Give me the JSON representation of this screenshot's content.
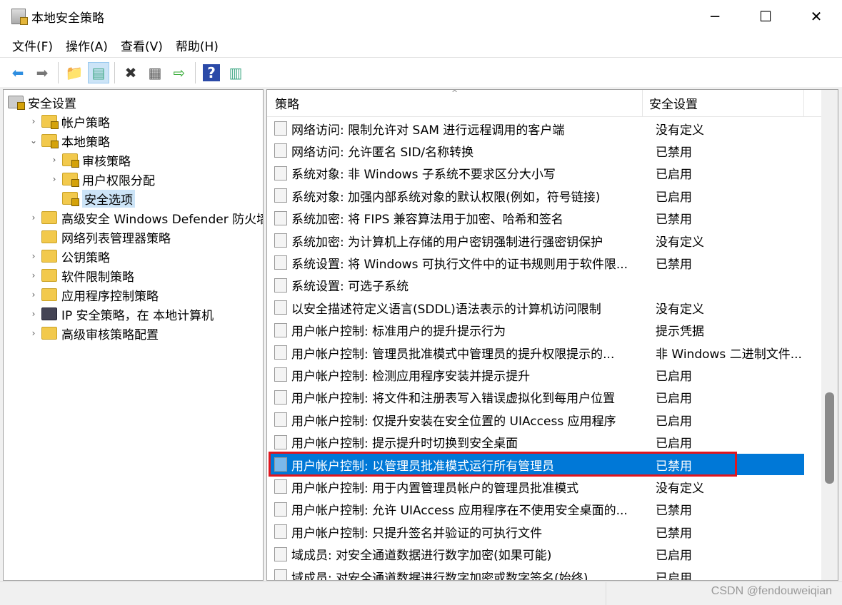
{
  "window": {
    "title": "本地安全策略",
    "minimize": "─",
    "maximize": "☐",
    "close": "✕"
  },
  "menu": [
    "文件(F)",
    "操作(A)",
    "查看(V)",
    "帮助(H)"
  ],
  "toolbar": [
    {
      "name": "back-icon",
      "glyph": "⬅",
      "color": "#2e8ee0",
      "active": false
    },
    {
      "name": "forward-icon",
      "glyph": "➡",
      "color": "#777",
      "active": false
    },
    {
      "sep": true
    },
    {
      "name": "up-folder-icon",
      "glyph": "📁",
      "color": "#d9a520",
      "active": false
    },
    {
      "name": "show-hide-tree-icon",
      "glyph": "▤",
      "color": "#4a8",
      "active": true
    },
    {
      "sep": true
    },
    {
      "name": "delete-icon",
      "glyph": "✖",
      "color": "#333",
      "active": false
    },
    {
      "name": "properties-icon",
      "glyph": "▦",
      "color": "#555",
      "active": false
    },
    {
      "name": "export-list-icon",
      "glyph": "⇨",
      "color": "#3a3",
      "active": false
    },
    {
      "sep": true
    },
    {
      "name": "help-icon",
      "glyph": "?",
      "color": "#fff",
      "bg": "#2b4aa8",
      "active": false
    },
    {
      "name": "show-action-pane-icon",
      "glyph": "▥",
      "color": "#4a8",
      "active": false
    }
  ],
  "tree": [
    {
      "label": "安全设置",
      "level": 0,
      "chev": "",
      "icon": "shield"
    },
    {
      "label": "帐户策略",
      "level": 1,
      "chev": "›",
      "icon": "lock"
    },
    {
      "label": "本地策略",
      "level": 1,
      "chev": "⌄",
      "icon": "lock"
    },
    {
      "label": "审核策略",
      "level": 2,
      "chev": "›",
      "icon": "lock"
    },
    {
      "label": "用户权限分配",
      "level": 2,
      "chev": "›",
      "icon": "lock"
    },
    {
      "label": "安全选项",
      "level": 2,
      "chev": "",
      "icon": "lock",
      "selected": true
    },
    {
      "label": "高级安全 Windows Defender 防火墙",
      "level": 1,
      "chev": "›",
      "icon": "folder"
    },
    {
      "label": "网络列表管理器策略",
      "level": 1,
      "chev": "",
      "icon": "folder"
    },
    {
      "label": "公钥策略",
      "level": 1,
      "chev": "›",
      "icon": "folder"
    },
    {
      "label": "软件限制策略",
      "level": 1,
      "chev": "›",
      "icon": "folder"
    },
    {
      "label": "应用程序控制策略",
      "level": 1,
      "chev": "›",
      "icon": "folder"
    },
    {
      "label": "IP 安全策略，在 本地计算机",
      "level": 1,
      "chev": "›",
      "icon": "ipsec"
    },
    {
      "label": "高级审核策略配置",
      "level": 1,
      "chev": "›",
      "icon": "folder"
    }
  ],
  "list": {
    "columns": [
      "策略",
      "安全设置"
    ],
    "rows": [
      [
        "网络访问: 限制允许对 SAM 进行远程调用的客户端",
        "没有定义"
      ],
      [
        "网络访问: 允许匿名 SID/名称转换",
        "已禁用"
      ],
      [
        "系统对象: 非 Windows 子系统不要求区分大小写",
        "已启用"
      ],
      [
        "系统对象: 加强内部系统对象的默认权限(例如，符号链接)",
        "已启用"
      ],
      [
        "系统加密: 将 FIPS 兼容算法用于加密、哈希和签名",
        "已禁用"
      ],
      [
        "系统加密: 为计算机上存储的用户密钥强制进行强密钥保护",
        "没有定义"
      ],
      [
        "系统设置: 将 Windows 可执行文件中的证书规则用于软件限...",
        "已禁用"
      ],
      [
        "系统设置: 可选子系统",
        ""
      ],
      [
        "以安全描述符定义语言(SDDL)语法表示的计算机访问限制",
        "没有定义"
      ],
      [
        "用户帐户控制: 标准用户的提升提示行为",
        "提示凭据"
      ],
      [
        "用户帐户控制: 管理员批准模式中管理员的提升权限提示的...",
        "非 Windows 二进制文件..."
      ],
      [
        "用户帐户控制: 检测应用程序安装并提示提升",
        "已启用"
      ],
      [
        "用户帐户控制: 将文件和注册表写入错误虚拟化到每用户位置",
        "已启用"
      ],
      [
        "用户帐户控制: 仅提升安装在安全位置的 UIAccess 应用程序",
        "已启用"
      ],
      [
        "用户帐户控制: 提示提升时切换到安全桌面",
        "已启用"
      ],
      [
        "用户帐户控制: 以管理员批准模式运行所有管理员",
        "已禁用"
      ],
      [
        "用户帐户控制: 用于内置管理员帐户的管理员批准模式",
        "没有定义"
      ],
      [
        "用户帐户控制: 允许 UIAccess 应用程序在不使用安全桌面的...",
        "已禁用"
      ],
      [
        "用户帐户控制: 只提升签名并验证的可执行文件",
        "已禁用"
      ],
      [
        "域成员: 对安全通道数据进行数字加密(如果可能)",
        "已启用"
      ],
      [
        "域成员: 对安全通道数据进行数字加密或数字签名(始终)",
        "已启用"
      ]
    ],
    "selected_index": 15,
    "highlight_color": "#e0161e",
    "selection_color": "#0078d7"
  },
  "watermark": "CSDN @fendouweiqian"
}
